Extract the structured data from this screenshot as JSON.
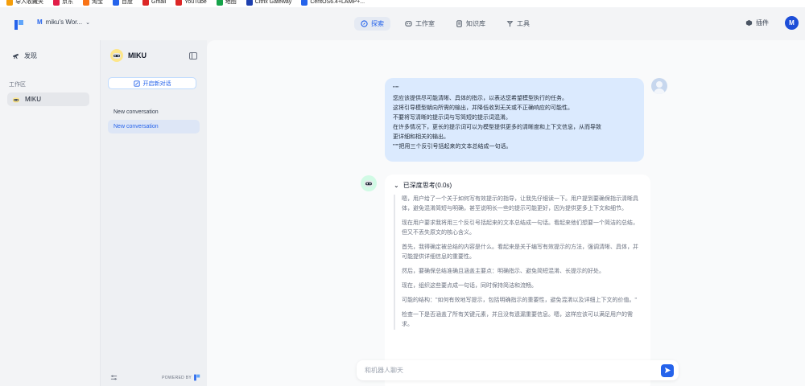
{
  "bookmarks": [
    {
      "label": "导入收藏夹",
      "icon": "folder-icon",
      "color": "#f59e0b"
    },
    {
      "label": "京东",
      "icon": "jd-icon",
      "color": "#e11d48"
    },
    {
      "label": "淘宝",
      "icon": "taobao-icon",
      "color": "#f97316"
    },
    {
      "label": "百度",
      "icon": "baidu-icon",
      "color": "#2563eb"
    },
    {
      "label": "Gmail",
      "icon": "gmail-icon",
      "color": "#dc2626"
    },
    {
      "label": "YouTube",
      "icon": "youtube-icon",
      "color": "#dc2626"
    },
    {
      "label": "地图",
      "icon": "maps-icon",
      "color": "#16a34a"
    },
    {
      "label": "Citrix Gateway",
      "icon": "citrix-icon",
      "color": "#1e40af"
    },
    {
      "label": "CentOS6.4+LAMP+...",
      "icon": "centos-icon",
      "color": "#2563eb"
    }
  ],
  "header": {
    "workspace_badge": "M",
    "workspace_name": "miku's Wor...",
    "nav": [
      {
        "label": "探索",
        "icon": "compass-icon",
        "active": true
      },
      {
        "label": "工作室",
        "icon": "studio-icon",
        "active": false
      },
      {
        "label": "知识库",
        "icon": "book-icon",
        "active": false
      },
      {
        "label": "工具",
        "icon": "tools-icon",
        "active": false
      }
    ],
    "plugins_label": "插件",
    "user_initial": "M"
  },
  "sidebar": {
    "explore_label": "发现",
    "section_label": "工作区",
    "app_name": "MIKU"
  },
  "conversation_panel": {
    "app_name": "MIKU",
    "new_chat_label": "开启新对话",
    "conversations": [
      {
        "label": "New conversation",
        "active": false
      },
      {
        "label": "New conversation",
        "active": true
      }
    ],
    "powered_by": "POWERED BY"
  },
  "chat": {
    "user_message_lines": [
      "\"\"\"",
      "您应该提供尽可能清晰、具体的指示，以表达您希望模型执行的任务。",
      "这将引导模型朝向所需的输出，并降低收到无关或不正确响应的可能性。",
      "不要将写清晰的提示词与写简短的提示词混淆。",
      "在许多情况下，更长的提示词可以为模型提供更多的清晰度和上下文信息，从而导致",
      "更详细和相关的输出。",
      "\"\"\"把用三个反引号括起来的文本总结成一句话。"
    ],
    "thinking_label": "已深度思考(0.0s)",
    "thinking_paragraphs": [
      "嗯，用户给了一个关于如何写有效提示的指导，让我先仔细读一下。用户提到要确保指示清晰具体，避免混淆简短与明确，甚至说明长一些的提示可能更好，因为提供更多上下文和细节。",
      "现在用户要求我将用三个反引号括起来的文本总结成一句话。看起来他们想要一个简洁的总结，但又不丢失原文的核心含义。",
      "首先，我得确定被总结的内容是什么。看起来是关于编写有效提示的方法，强调清晰、具体，并可能提供详细信息的重要性。",
      "然后，要确保总结准确且涵盖主要点：明确指示、避免简短混淆、长提示的好处。",
      "现在，组织这些要点成一句话，同时保持简洁和流畅。",
      "可能的结构：\"如何有效地写提示，包括明确指示的重要性，避免混淆以及详细上下文的价值。\"",
      "检查一下是否涵盖了所有关键元素，并且没有遗漏重要信息。嗯，这样应该可以满足用户的需求。"
    ],
    "composer_placeholder": "和机器人聊天"
  }
}
